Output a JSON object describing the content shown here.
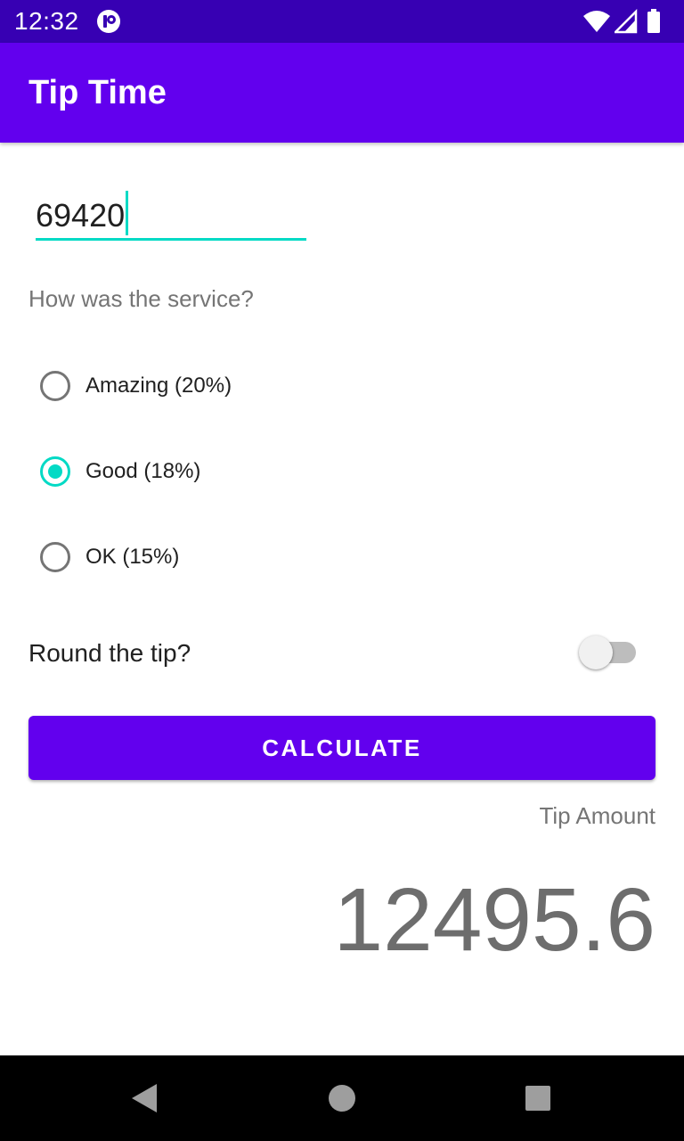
{
  "status_bar": {
    "time": "12:32",
    "icons": [
      "notification-icon",
      "wifi-icon",
      "cell-signal-icon",
      "battery-icon"
    ]
  },
  "app_bar": {
    "title": "Tip Time",
    "color": "#6200ee"
  },
  "cost_of_service": {
    "value": "69420"
  },
  "service_question": "How was the service?",
  "tip_options": [
    {
      "label": "Amazing (20%)",
      "checked": false
    },
    {
      "label": "Good (18%)",
      "checked": true
    },
    {
      "label": "OK (15%)",
      "checked": false
    }
  ],
  "round_tip": {
    "label": "Round the tip?",
    "on": false
  },
  "calculate_button": {
    "label": "CALCULATE"
  },
  "result": {
    "label": "Tip Amount",
    "value": "12495.6"
  },
  "nav_bar": {
    "icons": [
      "back-icon",
      "home-icon",
      "recents-icon"
    ]
  },
  "colors": {
    "primary": "#6200ee",
    "primary_dark": "#3700b3",
    "accent": "#03dac5"
  }
}
